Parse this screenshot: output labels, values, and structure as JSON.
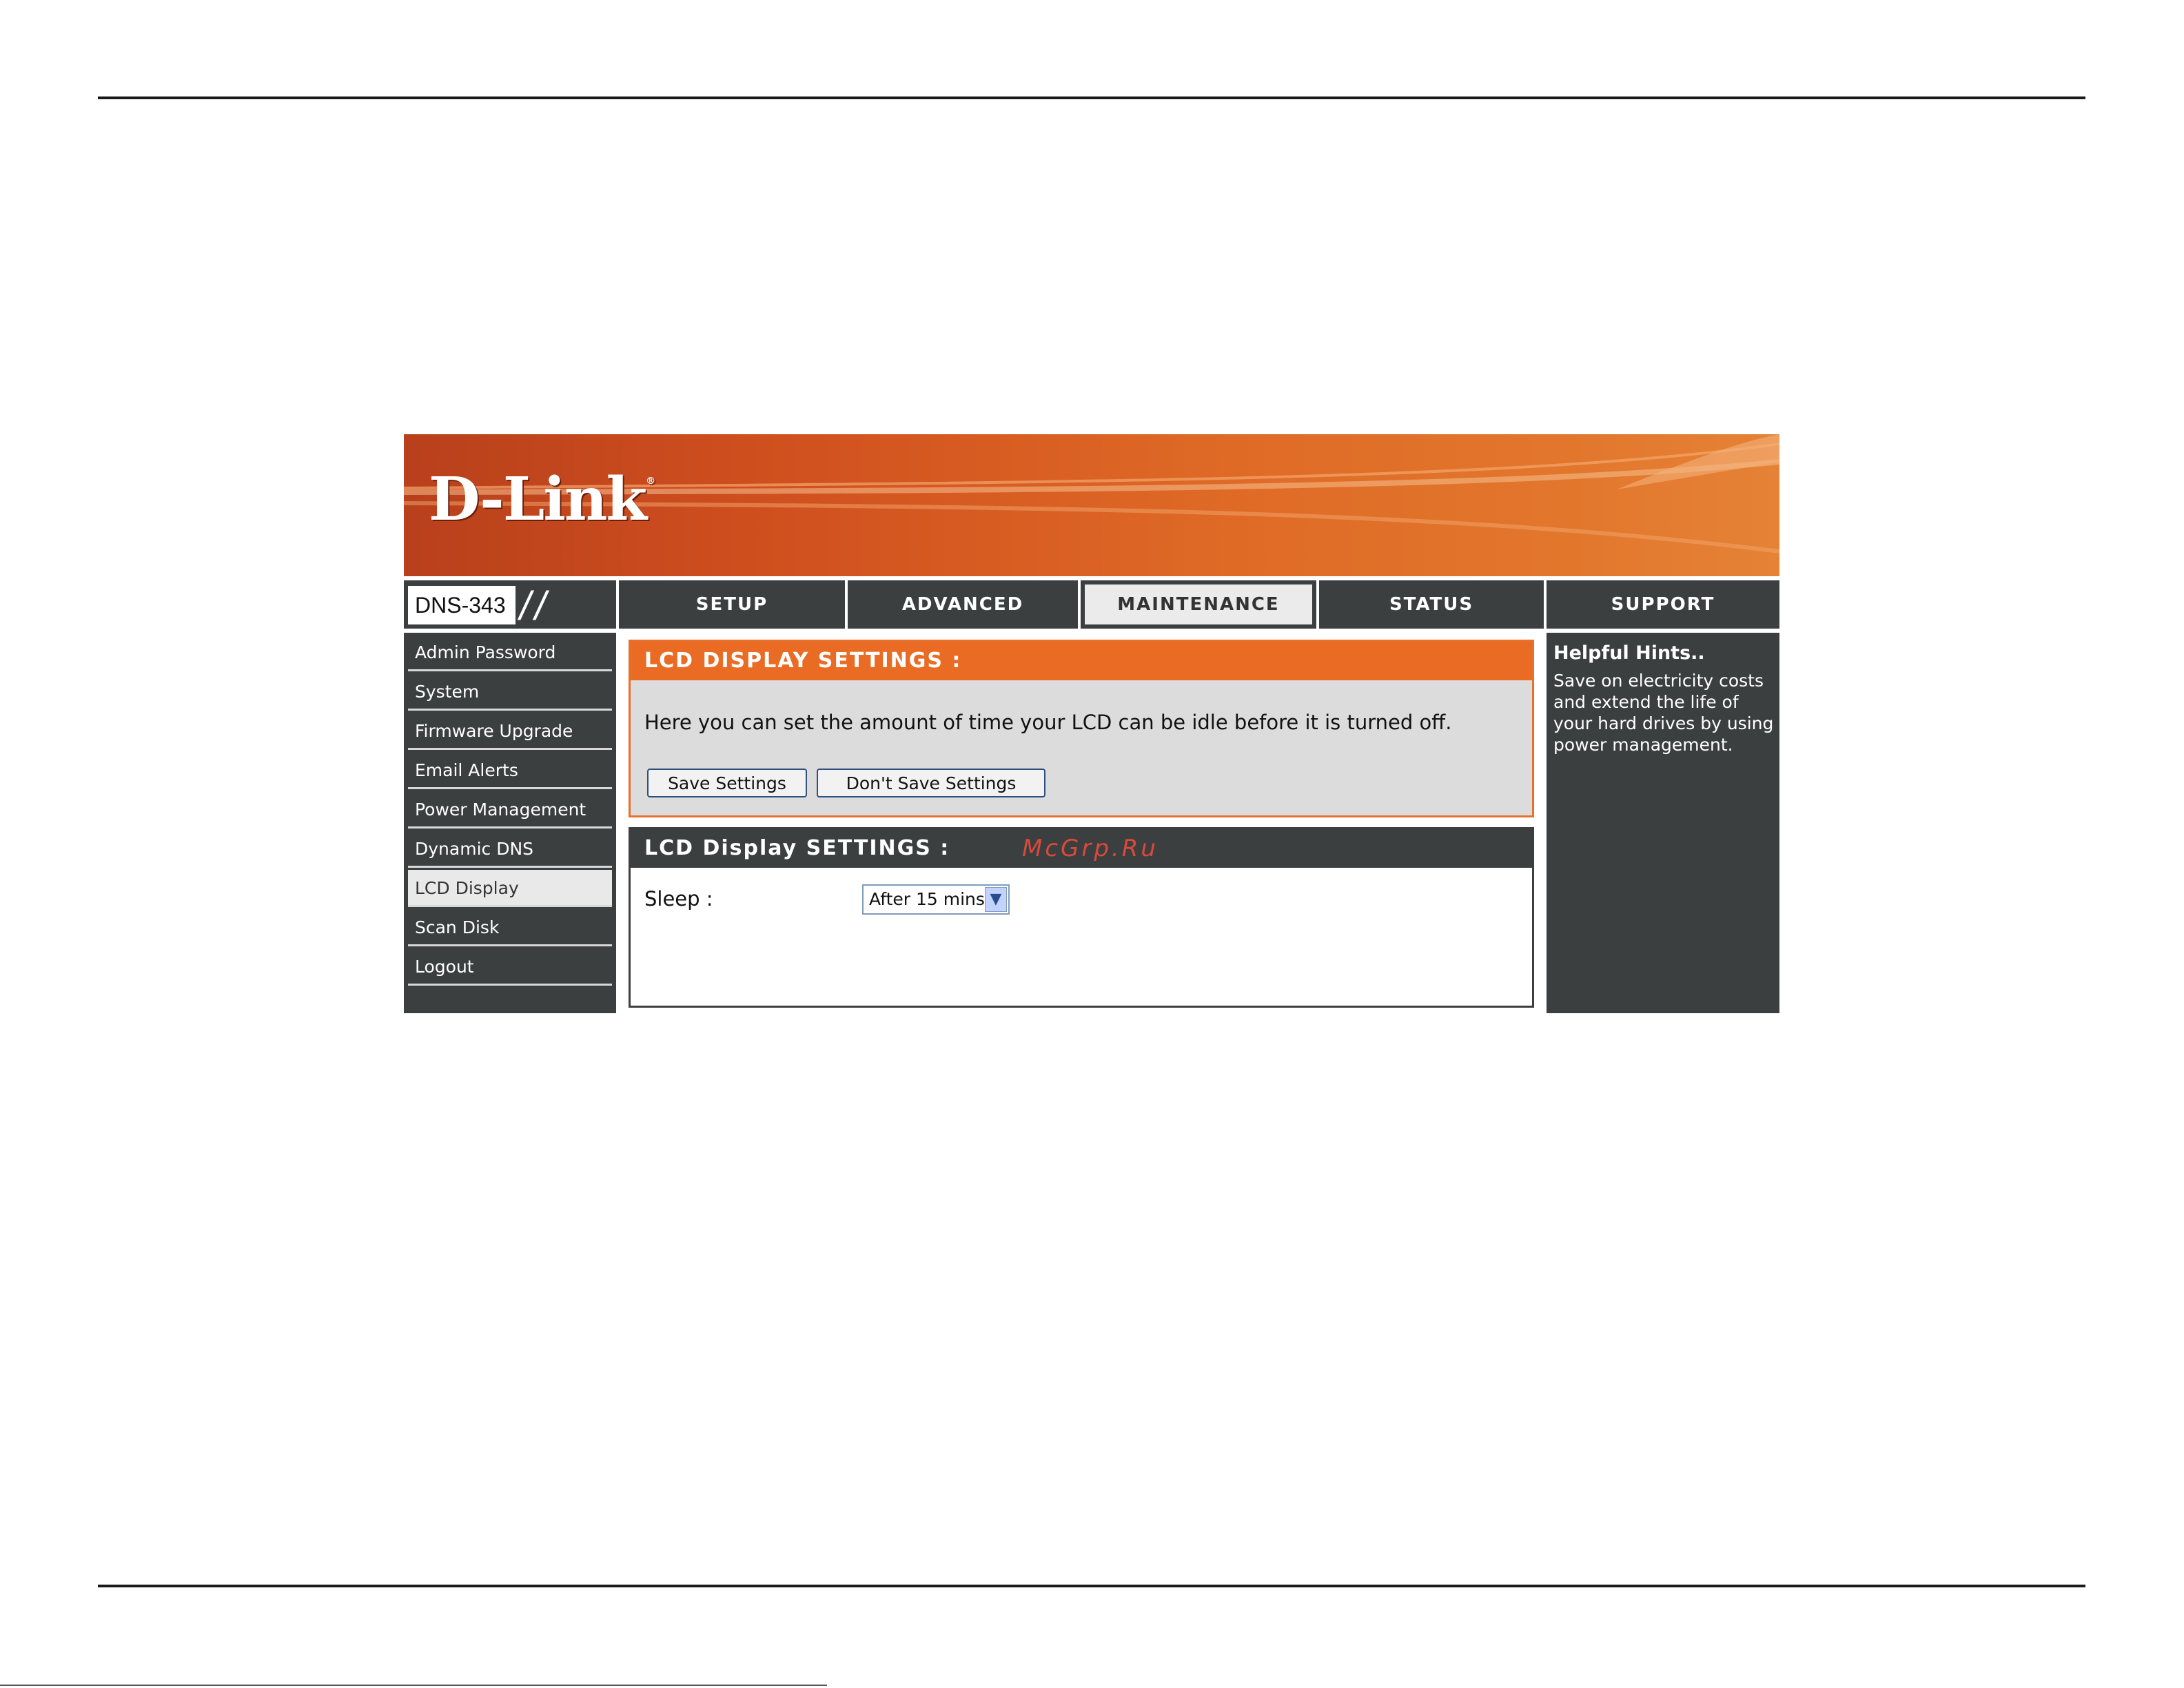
{
  "brand": {
    "logo": "D-Link",
    "reg": "®"
  },
  "model": "DNS-343",
  "nav": {
    "tabs": [
      {
        "label": "SETUP"
      },
      {
        "label": "ADVANCED"
      },
      {
        "label": "MAINTENANCE",
        "active": true
      },
      {
        "label": "STATUS"
      },
      {
        "label": "SUPPORT"
      }
    ]
  },
  "sidebar": {
    "items": [
      {
        "label": "Admin Password"
      },
      {
        "label": "System"
      },
      {
        "label": "Firmware Upgrade"
      },
      {
        "label": "Email Alerts"
      },
      {
        "label": "Power Management"
      },
      {
        "label": "Dynamic DNS"
      },
      {
        "label": "LCD Display",
        "active": true
      },
      {
        "label": "Scan Disk"
      },
      {
        "label": "Logout"
      }
    ]
  },
  "main": {
    "panel1": {
      "title": "LCD DISPLAY SETTINGS :",
      "description": "Here you can set the amount of time your LCD can be idle before it is turned off.",
      "save_label": "Save Settings",
      "dont_save_label": "Don't Save Settings"
    },
    "panel2": {
      "title": "LCD Display SETTINGS :",
      "watermark": "McGrp.Ru",
      "sleep_label": "Sleep :",
      "sleep_value": "After 15 mins"
    }
  },
  "hints": {
    "title": "Helpful Hints..",
    "body": "Save on electricity costs and extend the life of your hard drives by using power management."
  },
  "colors": {
    "accent": "#ea6c24",
    "dark": "#3b3f40",
    "banner": "#cf4e1e"
  }
}
